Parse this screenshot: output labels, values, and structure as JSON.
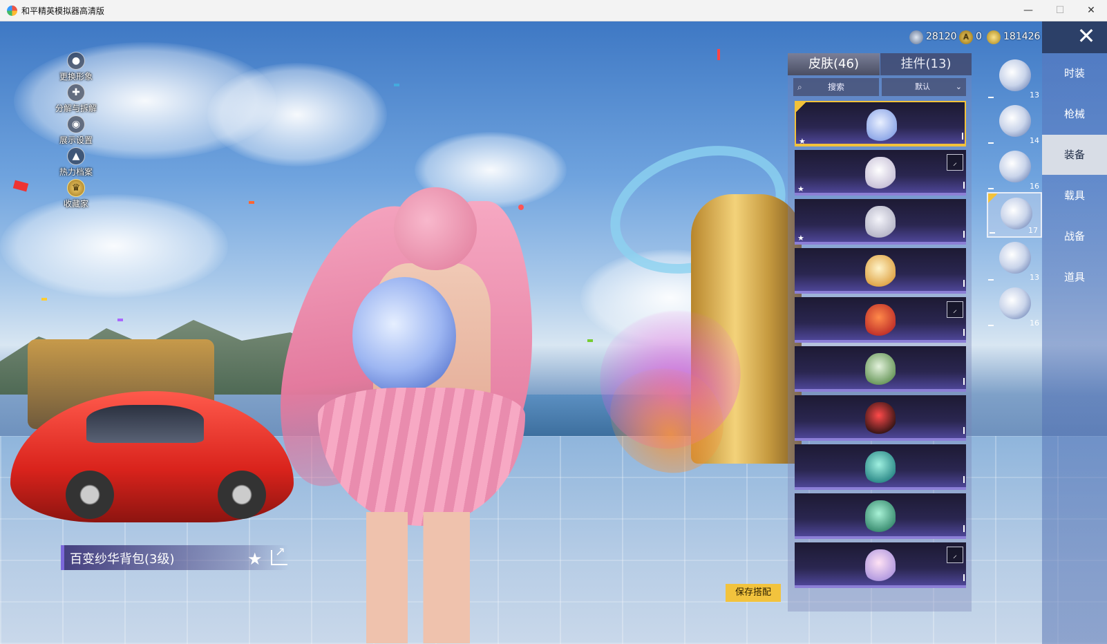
{
  "window": {
    "title": "和平精英模拟器高清版",
    "min_glyph": "—",
    "max_glyph": "☐",
    "close_glyph": "✕"
  },
  "currency": [
    {
      "icon": "globe-coin-icon",
      "value": "28120",
      "color": "#b9c6d8"
    },
    {
      "icon": "gold-a-coin-icon",
      "value": "0",
      "color": "#f0c33a"
    },
    {
      "icon": "gold-coupon-icon",
      "value": "181426",
      "color": "#e7c64a"
    }
  ],
  "left_menu": [
    {
      "label": "更换形象",
      "icon": "person-icon",
      "glyph": "●"
    },
    {
      "label": "分解与拆解",
      "icon": "puzzle-icon",
      "glyph": "✚"
    },
    {
      "label": "展示设置",
      "icon": "eye-icon",
      "glyph": "◉"
    },
    {
      "label": "热力档案",
      "icon": "flame-icon",
      "glyph": "▲"
    },
    {
      "label": "收藏家",
      "icon": "collector-badge-icon",
      "glyph": "♛"
    }
  ],
  "tabs": {
    "skins": "皮肤(46)",
    "pendants": "挂件(13)"
  },
  "toolbar": {
    "search_label": "搜索",
    "sort_label": "默认",
    "search_glyph": "⌕",
    "chevron_glyph": "⌄"
  },
  "items": [
    {
      "name": "blue-flower-backpack",
      "colors": [
        "#e9f0ff",
        "#8fa8e8"
      ],
      "selected": true,
      "starred": true,
      "badge": ""
    },
    {
      "name": "crystal-ball-backpack",
      "colors": [
        "#ffffff",
        "#c9c2d8"
      ],
      "selected": false,
      "starred": true,
      "badge": "⸝"
    },
    {
      "name": "white-bunny-backpack",
      "colors": [
        "#f5f5fb",
        "#b7b7c8"
      ],
      "selected": false,
      "starred": true,
      "badge": ""
    },
    {
      "name": "bunny-cupcake-backpack",
      "colors": [
        "#fff4c9",
        "#e0a64a"
      ],
      "selected": false,
      "starred": false,
      "badge": ""
    },
    {
      "name": "red-fox-backpack",
      "colors": [
        "#ff8a4a",
        "#c2332a"
      ],
      "selected": false,
      "starred": false,
      "badge": "⸝"
    },
    {
      "name": "green-bunny-backpack",
      "colors": [
        "#e3f2dc",
        "#6c9a5e"
      ],
      "selected": false,
      "starred": false,
      "badge": ""
    },
    {
      "name": "red-black-armor-backpack",
      "colors": [
        "#ff4a4a",
        "#3b1616"
      ],
      "selected": false,
      "starred": false,
      "badge": ""
    },
    {
      "name": "teal-dragon-backpack",
      "colors": [
        "#9ff0e0",
        "#2f8c8a"
      ],
      "selected": false,
      "starred": false,
      "badge": ""
    },
    {
      "name": "teal-globe-backpack",
      "colors": [
        "#a8f2d6",
        "#3d8f73"
      ],
      "selected": false,
      "starred": false,
      "badge": ""
    },
    {
      "name": "white-dragon-backpack",
      "colors": [
        "#ffe2f4",
        "#b39be0"
      ],
      "selected": false,
      "starred": false,
      "badge": "⸝"
    }
  ],
  "slots": [
    {
      "num": "13",
      "selected": false
    },
    {
      "num": "14",
      "selected": false
    },
    {
      "num": "16",
      "selected": false
    },
    {
      "num": "17",
      "selected": true
    },
    {
      "num": "13",
      "selected": false
    },
    {
      "num": "16",
      "selected": false
    }
  ],
  "categories": [
    {
      "label": "时装",
      "active": false
    },
    {
      "label": "枪械",
      "active": false
    },
    {
      "label": "装备",
      "active": true
    },
    {
      "label": "载具",
      "active": false
    },
    {
      "label": "战备",
      "active": false
    },
    {
      "label": "道具",
      "active": false
    }
  ],
  "selected_item": {
    "name": "百变纱华背包(3级)"
  },
  "save_button": "保存搭配",
  "fav_glyph": "★"
}
